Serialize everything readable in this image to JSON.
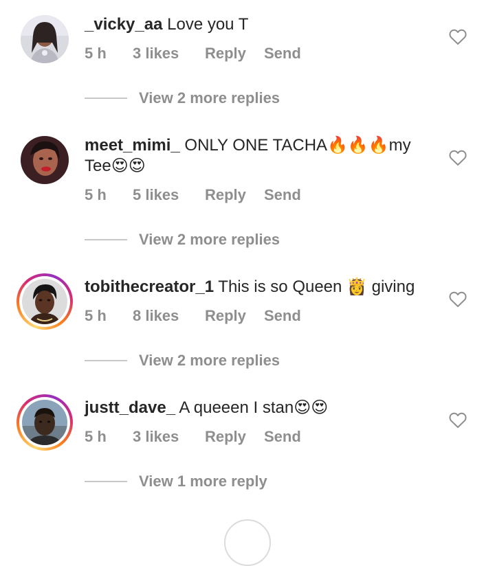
{
  "colors": {
    "text_primary": "#262626",
    "text_secondary": "#8e8e8e",
    "divider": "#c7c7c7"
  },
  "comments": [
    {
      "username": "_vicky_aa",
      "text": "Love you T",
      "time": "5 h",
      "likes": "3 likes",
      "reply_label": "Reply",
      "send_label": "Send",
      "view_replies": "View 2 more replies",
      "story_ring": false
    },
    {
      "username": "meet_mimi_",
      "text": "ONLY ONE TACHA🔥🔥🔥my Tee😍😍",
      "time": "5 h",
      "likes": "5 likes",
      "reply_label": "Reply",
      "send_label": "Send",
      "view_replies": "View 2 more replies",
      "story_ring": false
    },
    {
      "username": "tobithecreator_1",
      "text": "This is so Queen 👸 giving",
      "time": "5 h",
      "likes": "8 likes",
      "reply_label": "Reply",
      "send_label": "Send",
      "view_replies": "View 2 more replies",
      "story_ring": true
    },
    {
      "username": "justt_dave_",
      "text": "A queeen I stan😍😍",
      "time": "5 h",
      "likes": "3 likes",
      "reply_label": "Reply",
      "send_label": "Send",
      "view_replies": "View 1 more reply",
      "story_ring": true
    }
  ]
}
